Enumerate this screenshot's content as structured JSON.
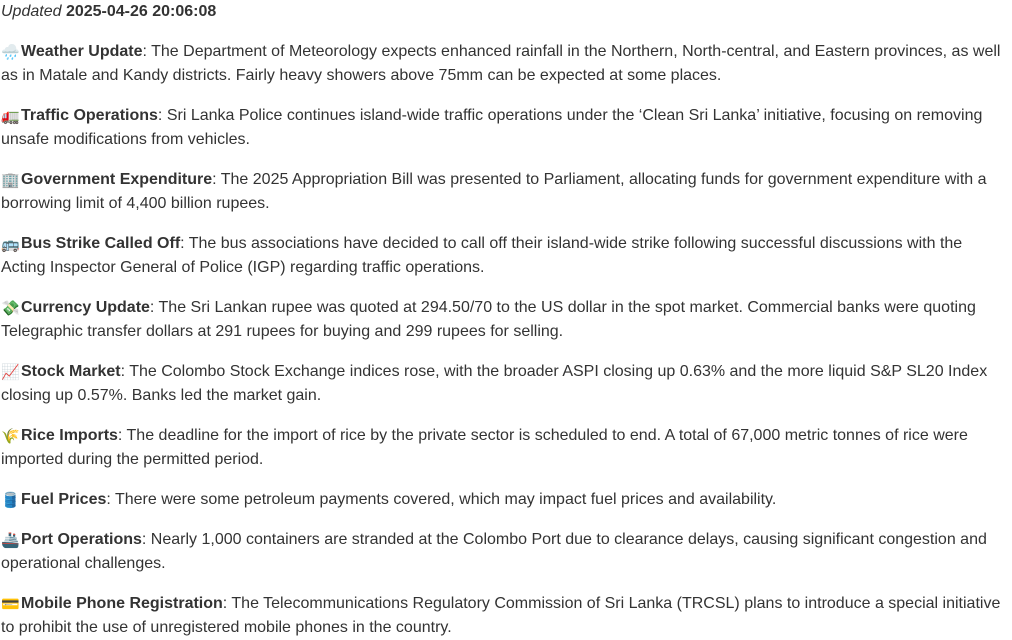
{
  "updated": {
    "label": "Updated",
    "timestamp": "2025-04-26 20:06:08"
  },
  "items": [
    {
      "emoji": "🌧️",
      "icon": "rain-cloud-icon",
      "title": "Weather Update",
      "text": ": The Department of Meteorology expects enhanced rainfall in the Northern, North-central, and Eastern provinces, as well as in Matale and Kandy districts. Fairly heavy showers above 75mm can be expected at some places."
    },
    {
      "emoji": "🚛",
      "icon": "truck-icon",
      "title": "Traffic Operations",
      "text": ": Sri Lanka Police continues island-wide traffic operations under the ‘Clean Sri Lanka’ initiative, focusing on removing unsafe modifications from vehicles."
    },
    {
      "emoji": "🏢",
      "icon": "office-building-icon",
      "title": "Government Expenditure",
      "text": ": The 2025 Appropriation Bill was presented to Parliament, allocating funds for government expenditure with a borrowing limit of 4,400 billion rupees."
    },
    {
      "emoji": "🚌",
      "icon": "bus-icon",
      "title": "Bus Strike Called Off",
      "text": ": The bus associations have decided to call off their island-wide strike following successful discussions with the Acting Inspector General of Police (IGP) regarding traffic operations."
    },
    {
      "emoji": "💸",
      "icon": "money-with-wings-icon",
      "title": "Currency Update",
      "text": ": The Sri Lankan rupee was quoted at 294.50/70 to the US dollar in the spot market. Commercial banks were quoting Telegraphic transfer dollars at 291 rupees for buying and 299 rupees for selling."
    },
    {
      "emoji": "📈",
      "icon": "chart-increasing-icon",
      "title": "Stock Market",
      "text": ": The Colombo Stock Exchange indices rose, with the broader ASPI closing up 0.63% and the more liquid S&P SL20 Index closing up 0.57%. Banks led the market gain."
    },
    {
      "emoji": "🌾",
      "icon": "rice-sheaf-icon",
      "title": "Rice Imports",
      "text": ": The deadline for the import of rice by the private sector is scheduled to end. A total of 67,000 metric tonnes of rice were imported during the permitted period."
    },
    {
      "emoji": "🛢️",
      "icon": "oil-drum-icon",
      "title": "Fuel Prices",
      "text": ": There were some petroleum payments covered, which may impact fuel prices and availability."
    },
    {
      "emoji": "🚢",
      "icon": "ship-icon",
      "title": "Port Operations",
      "text": ": Nearly 1,000 containers are stranded at the Colombo Port due to clearance delays, causing significant congestion and operational challenges."
    },
    {
      "emoji": "💳",
      "icon": "credit-card-icon",
      "title": "Mobile Phone Registration",
      "text": ": The Telecommunications Regulatory Commission of Sri Lanka (TRCSL) plans to introduce a special initiative to prohibit the use of unregistered mobile phones in the country."
    }
  ]
}
